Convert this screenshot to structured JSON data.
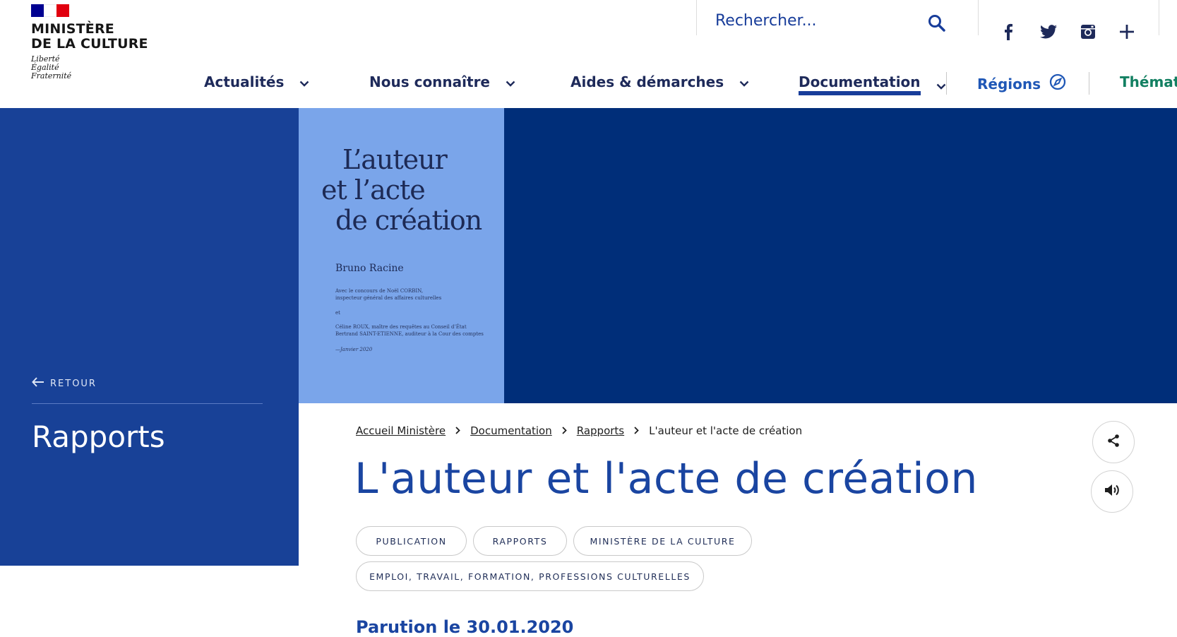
{
  "header": {
    "logo": {
      "ministry_line1": "MINISTÈRE",
      "ministry_line2": "DE LA CULTURE",
      "motto": [
        "Liberté",
        "Égalité",
        "Fraternité"
      ]
    },
    "search": {
      "placeholder": "Rechercher..."
    },
    "social": [
      "facebook-icon",
      "twitter-icon",
      "instagram-icon",
      "plus-icon"
    ]
  },
  "nav": {
    "items": [
      {
        "label": "Actualités"
      },
      {
        "label": "Nous connaître"
      },
      {
        "label": "Aides & démarches"
      },
      {
        "label": "Documentation"
      },
      {
        "label": "Régions"
      },
      {
        "label": "Thémati"
      }
    ],
    "active": "Documentation"
  },
  "sidebar": {
    "back_label": "RETOUR",
    "section_title": "Rapports"
  },
  "cover": {
    "title_lines": [
      "L’auteur",
      "et l’acte",
      "de création"
    ],
    "author": "Bruno Racine",
    "contrib1": [
      "Avec le concours de Noël CORBIN,",
      "inspecteur général des affaires culturelles"
    ],
    "contrib_et": "et",
    "contrib2": [
      "Céline ROUX, maître des requêtes au Conseil d’État",
      "Bertrand SAINT-ETIENNE, auditeur à la Cour des comptes"
    ],
    "date": "—Janvier 2020"
  },
  "breadcrumb": {
    "items": [
      "Accueil Ministère",
      "Documentation",
      "Rapports"
    ],
    "current": "L'auteur et l'acte de création"
  },
  "page": {
    "title": "L'auteur et l'acte de création",
    "tags": [
      "PUBLICATION",
      "RAPPORTS",
      "MINISTÈRE DE LA CULTURE",
      "EMPLOI, TRAVAIL, FORMATION, PROFESSIONS CULTURELLES"
    ],
    "date_text": "Parution le 30.01.2020"
  },
  "colors": {
    "navy": "#002e79",
    "blue": "#184197",
    "light_blue": "#7aa5ea",
    "title_blue": "#1a45a1"
  }
}
